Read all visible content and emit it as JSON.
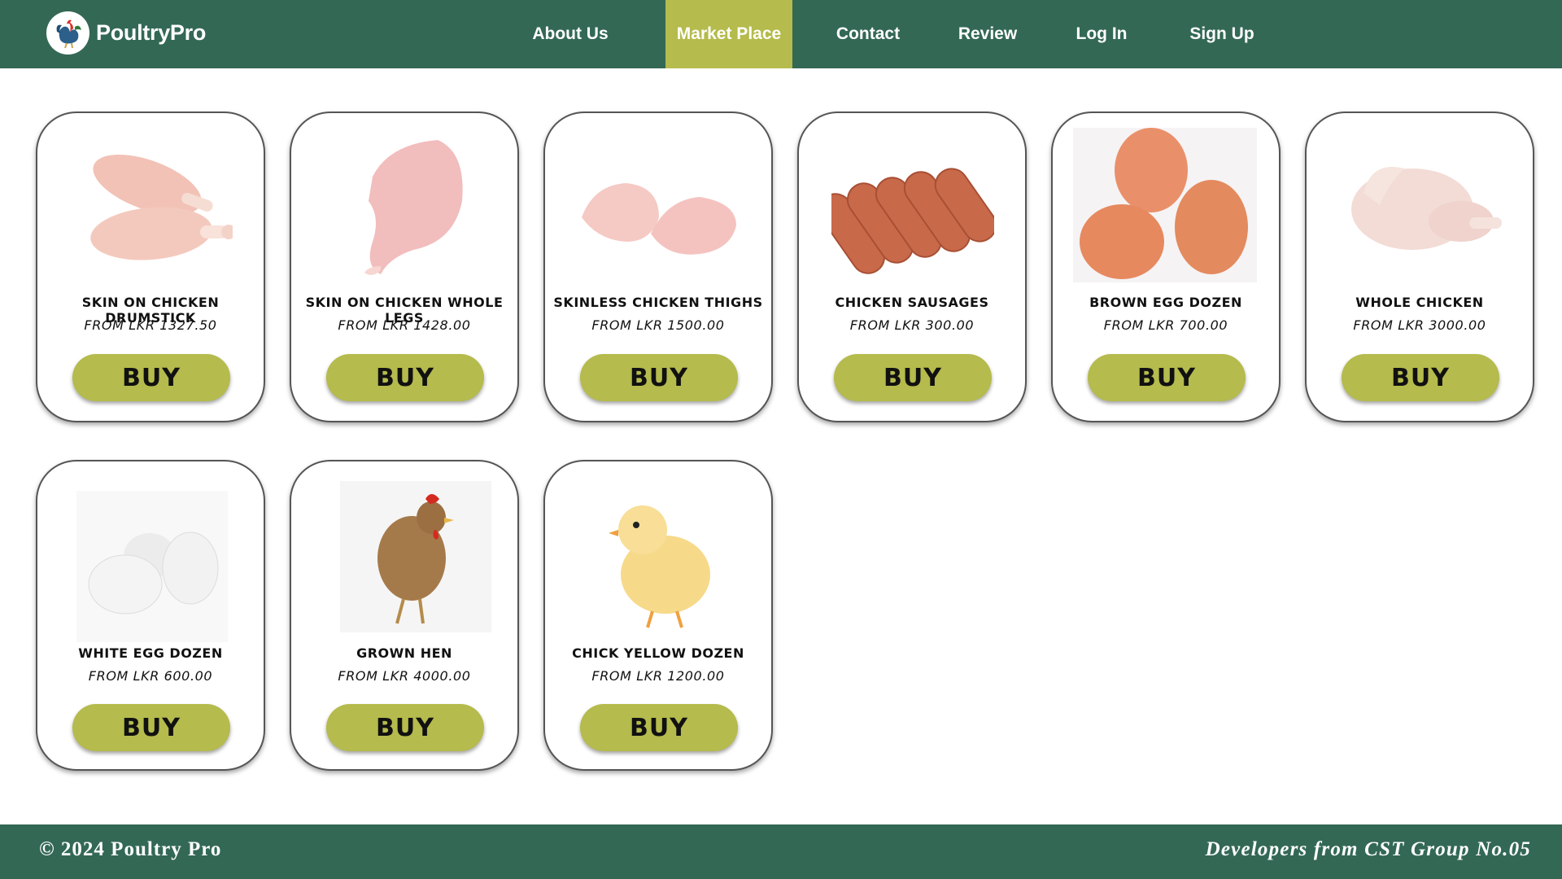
{
  "brand": {
    "name": "PoultryPro",
    "logo_icon": "rooster-icon"
  },
  "nav": {
    "items": [
      {
        "label": "About Us",
        "active": false
      },
      {
        "label": "Market Place",
        "active": true
      },
      {
        "label": "Contact",
        "active": false
      },
      {
        "label": "Review",
        "active": false
      },
      {
        "label": "Log In",
        "active": false
      },
      {
        "label": "Sign Up",
        "active": false
      }
    ]
  },
  "products": [
    {
      "title": "SKIN ON CHICKEN DRUMSTICK",
      "price": "FROM LKR 1327.50",
      "button": "BUY",
      "image_icon": "drumstick-image"
    },
    {
      "title": "SKIN ON CHICKEN WHOLE LEGS",
      "price": "FROM LKR 1428.00",
      "button": "BUY",
      "image_icon": "whole-leg-image"
    },
    {
      "title": "SKINLESS CHICKEN THIGHS",
      "price": "FROM LKR 1500.00",
      "button": "BUY",
      "image_icon": "thighs-image"
    },
    {
      "title": "CHICKEN SAUSAGES",
      "price": "FROM LKR 300.00",
      "button": "BUY",
      "image_icon": "sausages-image"
    },
    {
      "title": "BROWN EGG DOZEN",
      "price": "FROM LKR 700.00",
      "button": "BUY",
      "image_icon": "brown-eggs-image"
    },
    {
      "title": "WHOLE CHICKEN",
      "price": "FROM LKR 3000.00",
      "button": "BUY",
      "image_icon": "whole-chicken-image"
    },
    {
      "title": "WHITE EGG DOZEN",
      "price": "FROM LKR 600.00",
      "button": "BUY",
      "image_icon": "white-eggs-image"
    },
    {
      "title": "GROWN HEN",
      "price": "FROM LKR 4000.00",
      "button": "BUY",
      "image_icon": "hen-image"
    },
    {
      "title": "CHICK YELLOW DOZEN",
      "price": "FROM LKR 1200.00",
      "button": "BUY",
      "image_icon": "chick-image"
    }
  ],
  "footer": {
    "copyright": "© 2024 Poultry Pro",
    "credits": "Developers from CST Group No.05"
  },
  "colors": {
    "header_bg": "#336855",
    "accent": "#b5bb4c",
    "footer_bg": "#336855"
  }
}
